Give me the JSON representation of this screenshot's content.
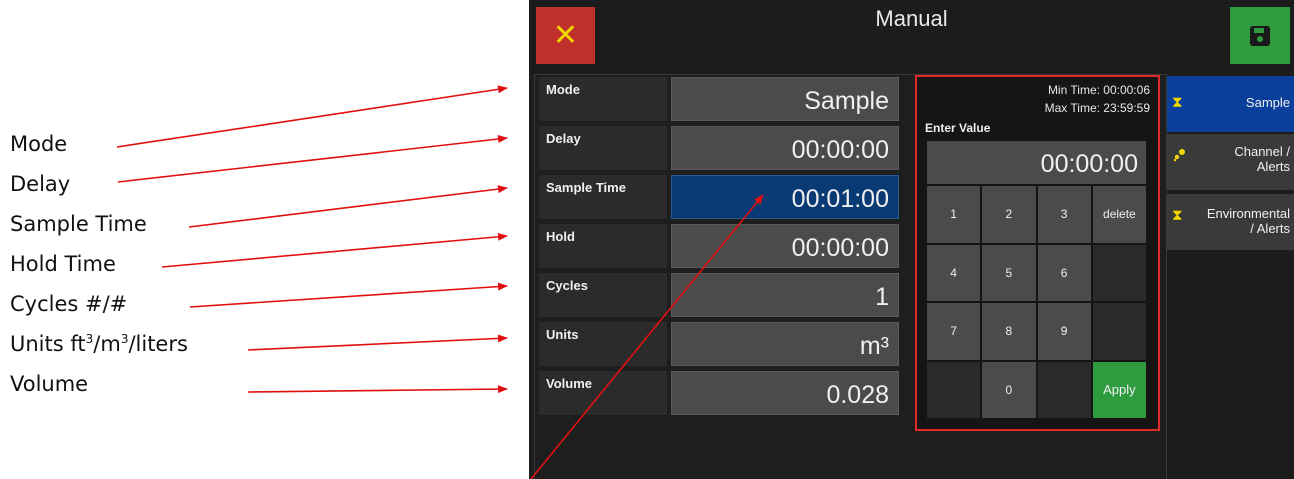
{
  "annotations": {
    "mode": "Mode",
    "delay": "Delay",
    "sample_time": "Sample Time",
    "hold_time": "Hold Time",
    "cycles": "Cycles #/#",
    "units_prefix": "Units ft",
    "units_mid1": "/m",
    "units_suffix": "/liters",
    "units_sup": "3",
    "volume": "Volume"
  },
  "header": {
    "title": "Manual",
    "close_icon": "✕"
  },
  "fields": [
    {
      "label": "Mode",
      "value": "Sample"
    },
    {
      "label": "Delay",
      "value": "00:00:00"
    },
    {
      "label": "Sample Time",
      "value": "00:01:00"
    },
    {
      "label": "Hold",
      "value": "00:00:00"
    },
    {
      "label": "Cycles",
      "value": "1"
    },
    {
      "label": "Units",
      "value": "m³"
    },
    {
      "label": "Volume",
      "value": "0.028"
    }
  ],
  "keypad": {
    "min_time": "Min Time: 00:00:06",
    "max_time": "Max Time: 23:59:59",
    "enter_label": "Enter Value",
    "display": "00:00:00",
    "keys": [
      "1",
      "2",
      "3",
      "delete",
      "4",
      "5",
      "6",
      "",
      "7",
      "8",
      "9",
      "",
      "",
      "0",
      "",
      "Apply"
    ]
  },
  "tabs": {
    "sample": "Sample",
    "channel_line1": "Channel /",
    "channel_line2": "Alerts",
    "env_line1": "Environmental",
    "env_line2": "/ Alerts"
  },
  "colors": {
    "accent_red": "#c0312b",
    "accent_green": "#2e9b3f",
    "active_field": "#0a3a73",
    "active_tab": "#0a3f9b",
    "arrow": "#e11010"
  }
}
